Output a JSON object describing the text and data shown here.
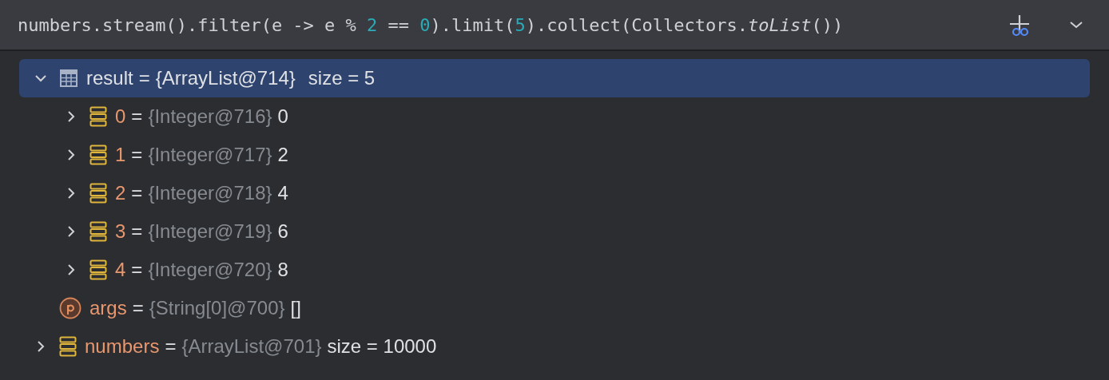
{
  "expression": {
    "tokens": [
      {
        "kind": "code",
        "text": "numbers.stream().filter(e -> e % "
      },
      {
        "kind": "number",
        "text": "2"
      },
      {
        "kind": "code",
        "text": " == "
      },
      {
        "kind": "number",
        "text": "0"
      },
      {
        "kind": "code",
        "text": ").limit("
      },
      {
        "kind": "number",
        "text": "5"
      },
      {
        "kind": "code",
        "text": ").collect(Collectors."
      },
      {
        "kind": "italic",
        "text": "toList"
      },
      {
        "kind": "code",
        "text": "())"
      }
    ]
  },
  "variables": [
    {
      "kind": "table",
      "name": "result",
      "separator": "=",
      "type": "{ArrayList@714}",
      "value": "size = 5",
      "expanded": true,
      "selected": true,
      "children": [
        {
          "kind": "field",
          "name": "0",
          "separator": "=",
          "type": "{Integer@716}",
          "value": "0",
          "expanded": false,
          "selected": false
        },
        {
          "kind": "field",
          "name": "1",
          "separator": "=",
          "type": "{Integer@717}",
          "value": "2",
          "expanded": false,
          "selected": false
        },
        {
          "kind": "field",
          "name": "2",
          "separator": "=",
          "type": "{Integer@718}",
          "value": "4",
          "expanded": false,
          "selected": false
        },
        {
          "kind": "field",
          "name": "3",
          "separator": "=",
          "type": "{Integer@719}",
          "value": "6",
          "expanded": false,
          "selected": false
        },
        {
          "kind": "field",
          "name": "4",
          "separator": "=",
          "type": "{Integer@720}",
          "value": "8",
          "expanded": false,
          "selected": false
        }
      ]
    },
    {
      "kind": "param",
      "name": "args",
      "separator": "=",
      "type": "{String[0]@700}",
      "value": "[]",
      "selected": false
    },
    {
      "kind": "field",
      "name": "numbers",
      "separator": "=",
      "type": "{ArrayList@701}",
      "value": "size = 10000",
      "expanded": false,
      "selected": false
    }
  ]
}
